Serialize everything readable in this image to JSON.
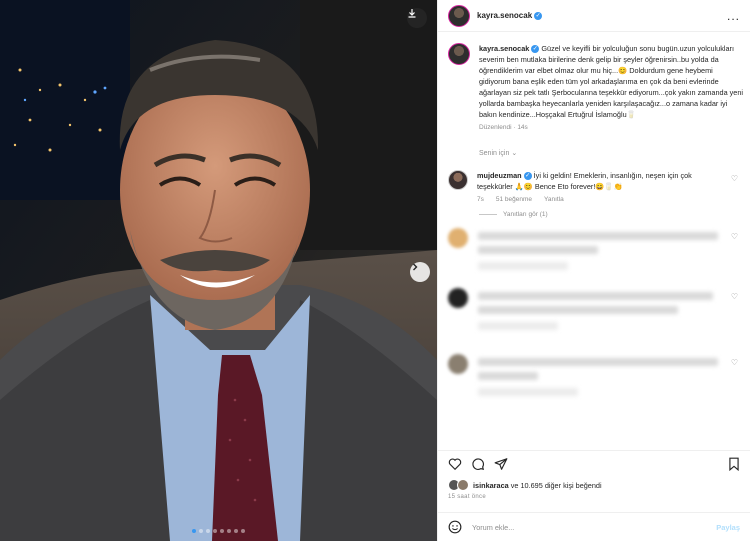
{
  "post": {
    "username": "kayra.senocak",
    "more_label": "...",
    "caption": "Güzel ve keyifli bir yolculuğun sonu bugün.uzun yolculukları severim ben mutlaka birilerine denk gelip bir şeyler öğrenirsin..bu yolda da öğrendiklerim var elbet olmaz olur mu hiç...😊 Doldurdum gene heybemi gidiyorum bana eşlik eden tüm yol arkadaşlarıma en çok da beni evlerinde ağarlayan siz pek tatlı Şerbocularına teşekkür ediyorum...çok yakın zamanda yeni yollarda bambaşka heyecanlarla yeniden karşılaşacağız...o zamana kadar iyi bakın kendinize...Hoşçakal Ertuğrul İslamoğlu🥛",
    "edited": "Düzenlendi",
    "edited_time": "14s",
    "for_you": "Senin için",
    "likes_text": "isinkaraca ve 10.695 diğer kişi beğendi",
    "likes_user": "isinkaraca",
    "likes_rest": "ve 10.695 diğer kişi beğendi",
    "time_ago": "15 saat önce"
  },
  "comment": {
    "username": "mujdeuzman",
    "text": "İyi ki geldin! Emeklerin, insanlığın, neşen için çok teşekkürler 🙏😊 Bence Eto forever!😄🥛👏",
    "time": "7s",
    "likes": "51 beğenme",
    "reply": "Yanıtla",
    "view_replies": "Yanıtları gör (1)"
  },
  "add_comment": {
    "placeholder": "Yorum ekle...",
    "post_label": "Paylaş"
  },
  "carousel": {
    "total": 8,
    "active": 1
  },
  "colors": {
    "accent": "#3897f0",
    "story_ring": "#d6249f"
  }
}
